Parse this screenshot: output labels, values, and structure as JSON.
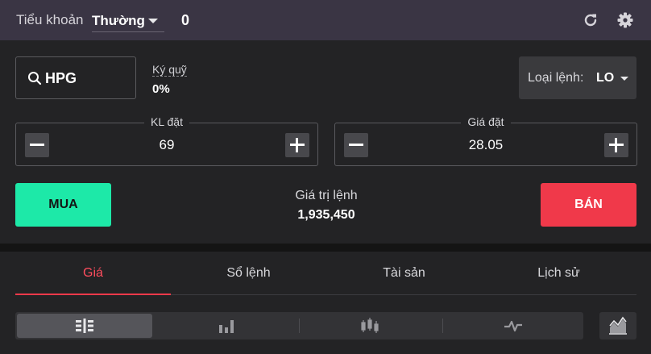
{
  "account": {
    "label": "Tiểu khoản",
    "type_value": "Thường",
    "number": "0"
  },
  "icons": {
    "refresh": "refresh-icon",
    "settings": "gear-icon",
    "search": "search-icon"
  },
  "order": {
    "symbol": "HPG",
    "margin_label": "Ký quỹ",
    "margin_value": "0%",
    "order_type_label": "Loại lệnh:",
    "order_type_value": "LO",
    "quantity_label": "KL đặt",
    "quantity_value": "69",
    "price_label": "Giá đặt",
    "price_value": "28.05",
    "order_value_label": "Giá trị lệnh",
    "order_value": "1,935,450",
    "buy_label": "MUA",
    "sell_label": "BÁN"
  },
  "tabs": [
    {
      "label": "Giá",
      "active": true
    },
    {
      "label": "Sổ lệnh",
      "active": false
    },
    {
      "label": "Tài sản",
      "active": false
    },
    {
      "label": "Lịch sử",
      "active": false
    }
  ],
  "colors": {
    "buy": "#1de9a8",
    "sell": "#f0394a",
    "active_tab": "#ff4d5e"
  }
}
